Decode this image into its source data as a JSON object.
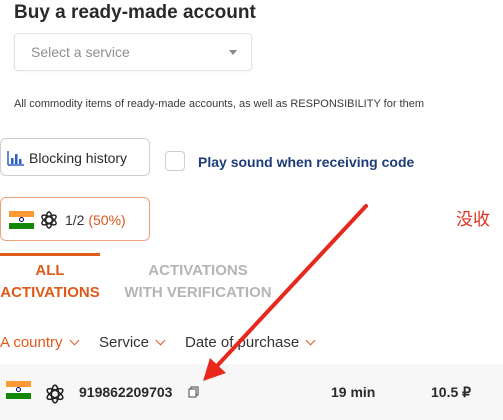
{
  "page_title": "Buy a ready-made account",
  "service_select": {
    "placeholder": "Select a service"
  },
  "notice": "All commodity items of ready-made accounts, as well as RESPONSIBILITY for them",
  "blocking_history": {
    "label": "Blocking history",
    "icon": "bar-chart-icon"
  },
  "play_sound": {
    "label": "Play sound when receiving code",
    "checked": false
  },
  "stats": {
    "count": "1/2",
    "percent": "(50%)",
    "country_icon": "india-flag-icon",
    "service_icon": "openai-icon"
  },
  "annotation_text": "没收",
  "tabs": [
    {
      "line1": "ALL",
      "line2": "ACTIVATIONS",
      "active": true
    },
    {
      "line1": "ACTIVATIONS",
      "line2": "WITH VERIFICATION",
      "active": false
    }
  ],
  "filters": {
    "country": "A country",
    "service": "Service",
    "date": "Date of purchase"
  },
  "row": {
    "phone": "919862209703",
    "time": "19 min",
    "price": "10.5 ₽"
  },
  "colors": {
    "accent": "#e05a1a",
    "label_blue": "#1d3c78",
    "annotation_red": "#e0301e"
  }
}
